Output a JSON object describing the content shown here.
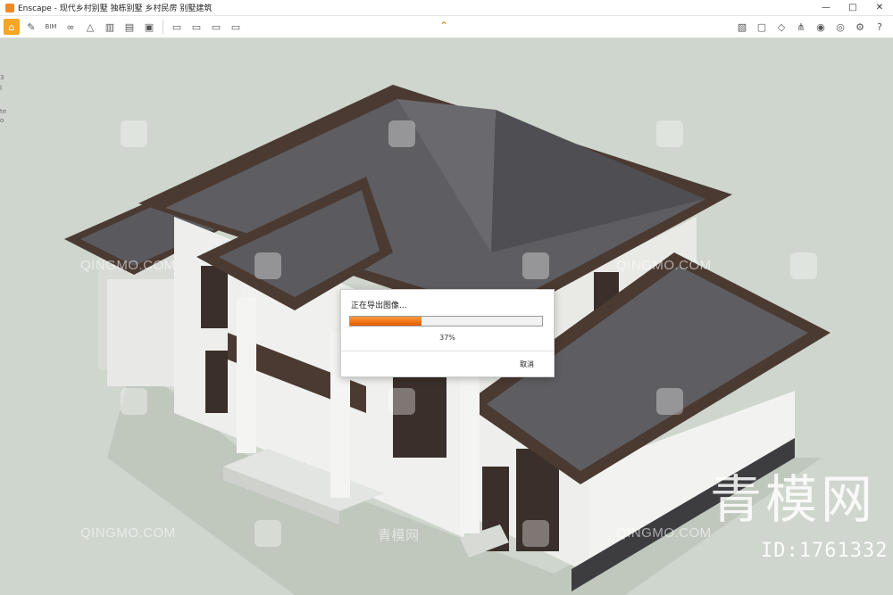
{
  "window": {
    "title": "Enscape - 现代乡村别墅 独栋别墅 乡村民房 别墅建筑",
    "controls": [
      "—",
      "□",
      "✕"
    ]
  },
  "toolbar": {
    "left_icons": [
      "home-icon",
      "asset-library-icon",
      "bim-icon",
      "binoculars-icon",
      "sketch-icon",
      "facade-icon",
      "building-icon",
      "video-icon"
    ],
    "mid_icons": [
      "export-image-icon",
      "batch-render-icon",
      "panorama-icon",
      "video-export-icon"
    ],
    "collapse_glyph": "⌃",
    "right_icons": [
      "map-icon",
      "view-icon",
      "cube-icon",
      "walk-icon",
      "vr-icon",
      "visibility-icon",
      "settings-icon",
      "help-icon"
    ]
  },
  "viewport": {
    "edge_texts": [
      "3",
      "l",
      "te",
      "o"
    ],
    "watermarks": {
      "latin": "QINGMO.COM",
      "cn": "青模网"
    },
    "brand": "青模网",
    "id": "ID:1761332"
  },
  "dialog": {
    "title": "正在导出图像...",
    "progress": 0.37,
    "percent_label": "37%",
    "cancel_label": "取消"
  },
  "colors": {
    "accent": "#f5a623",
    "progress": "#e45a00",
    "ground": "#cfd6cd",
    "roof": "#57575b",
    "wall": "#f1f2f0",
    "trim": "#4a3a32"
  }
}
